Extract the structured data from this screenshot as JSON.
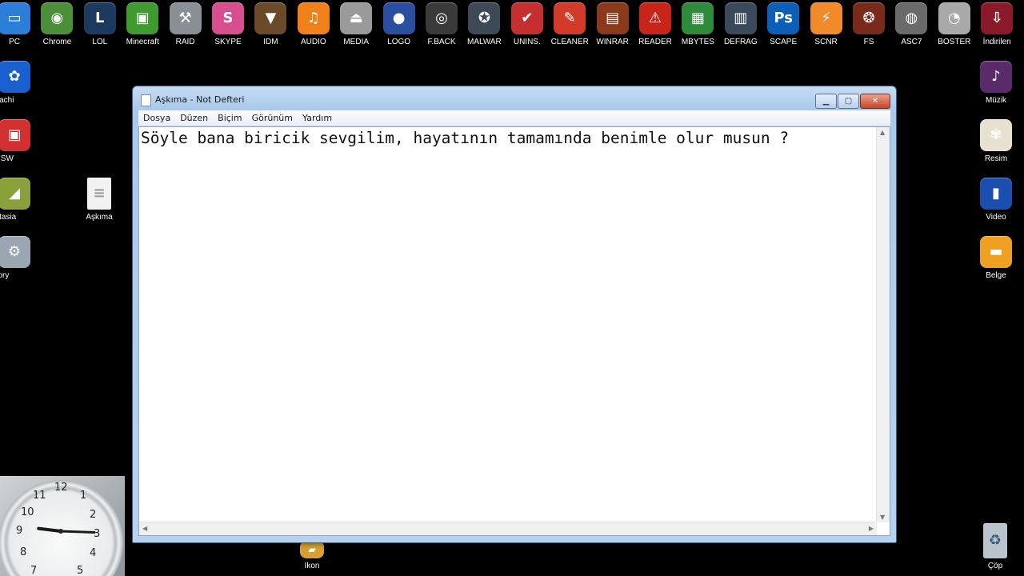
{
  "desktop": {
    "top_icons": [
      {
        "label": "PC",
        "icon": "monitor-icon",
        "color": "#2b7fd8",
        "glyph": "▭"
      },
      {
        "label": "Chrome",
        "icon": "chrome-icon",
        "color": "#4b8f3a",
        "glyph": "◉"
      },
      {
        "label": "LOL",
        "icon": "league-of-legends-icon",
        "color": "#1c3a60",
        "glyph": "L"
      },
      {
        "label": "Minecraft",
        "icon": "minecraft-creeper-icon",
        "color": "#3f9b2f",
        "glyph": "▣"
      },
      {
        "label": "RAID",
        "icon": "raid-tools-icon",
        "color": "#8a8f96",
        "glyph": "⚒"
      },
      {
        "label": "SKYPE",
        "icon": "skype-icon",
        "color": "#d84f8f",
        "glyph": "S"
      },
      {
        "label": "IDM",
        "icon": "idm-download-icon",
        "color": "#6b4a2a",
        "glyph": "▼"
      },
      {
        "label": "AUDIO",
        "icon": "music-note-icon",
        "color": "#f0801a",
        "glyph": "♫"
      },
      {
        "label": "MEDIA",
        "icon": "eject-icon",
        "color": "#9a9a9a",
        "glyph": "⏏"
      },
      {
        "label": "LOGO",
        "icon": "logo-icon",
        "color": "#2b4fa0",
        "glyph": "●"
      },
      {
        "label": "F.BACK",
        "icon": "camera-icon",
        "color": "#3a3a3a",
        "glyph": "◎"
      },
      {
        "label": "MALWAR",
        "icon": "shield-star-icon",
        "color": "#3d4a55",
        "glyph": "✪"
      },
      {
        "label": "UNINS.",
        "icon": "uninstall-icon",
        "color": "#c62f2f",
        "glyph": "✔"
      },
      {
        "label": "CLEANER",
        "icon": "broom-icon",
        "color": "#d23a2a",
        "glyph": "✎"
      },
      {
        "label": "WINRAR",
        "icon": "winrar-icon",
        "color": "#8a3a1a",
        "glyph": "▤"
      },
      {
        "label": "READER",
        "icon": "pdf-reader-icon",
        "color": "#c8241a",
        "glyph": "⚠"
      },
      {
        "label": "MBYTES",
        "icon": "windows-flag-icon",
        "color": "#2f8a3a",
        "glyph": "▦"
      },
      {
        "label": "DEFRAG",
        "icon": "defrag-icon",
        "color": "#3a4a5a",
        "glyph": "▥"
      },
      {
        "label": "SCAPE",
        "icon": "photoshop-icon",
        "color": "#0b5fb8",
        "glyph": "Ps"
      },
      {
        "label": "SCNR",
        "icon": "usb-icon",
        "color": "#f08a2a",
        "glyph": "⚡"
      },
      {
        "label": "FS",
        "icon": "film-reel-icon",
        "color": "#7a2a1a",
        "glyph": "❂"
      },
      {
        "label": "ASC7",
        "icon": "hard-drive-icon",
        "color": "#6a6a6a",
        "glyph": "◍"
      },
      {
        "label": "BOSTER",
        "icon": "gauge-icon",
        "color": "#a9a9a9",
        "glyph": "◔"
      },
      {
        "label": "İndirilen",
        "icon": "downloads-folder-icon",
        "color": "#8a1a2a",
        "glyph": "⇩"
      }
    ],
    "left_icons": [
      {
        "label": "Hamachi",
        "icon": "hamachi-icon",
        "color": "#1a5fd0",
        "glyph": "✿"
      },
      {
        "label": "MNCSW",
        "icon": "minecraft-server-icon",
        "color": "#d23030",
        "glyph": "▣"
      },
      {
        "label": "Camtasia",
        "icon": "camtasia-icon",
        "color": "#8aa03a",
        "glyph": "◢"
      },
      {
        "label": "Factory",
        "icon": "factory-icon",
        "color": "#9aa6b2",
        "glyph": "⚙"
      }
    ],
    "askima_icon": {
      "label": "Aşkıma",
      "icon": "text-file-icon",
      "color": "#e8e8e8",
      "glyph": "≡"
    },
    "right_icons": [
      {
        "label": "Müzik",
        "icon": "music-folder-icon",
        "color": "#5a2a6a",
        "glyph": "♪"
      },
      {
        "label": "Resim",
        "icon": "pictures-icon",
        "color": "#e8e0d0",
        "glyph": "✾"
      },
      {
        "label": "Video",
        "icon": "video-icon",
        "color": "#1a4fb0",
        "glyph": "▮"
      },
      {
        "label": "Belge",
        "icon": "documents-folder-icon",
        "color": "#f0a020",
        "glyph": "▬"
      }
    ],
    "bottom_icons": [
      {
        "label": "Ikon",
        "icon": "folder-icon",
        "color": "#d8a030",
        "glyph": "▰"
      },
      {
        "label": "Çöp",
        "icon": "recycle-bin-icon",
        "color": "#9aa8b4",
        "glyph": "♻"
      }
    ]
  },
  "notepad": {
    "title": "Aşkıma - Not Defteri",
    "menu": [
      "Dosya",
      "Düzen",
      "Biçim",
      "Görünüm",
      "Yardım"
    ],
    "content": "Söyle bana biricik sevgilim, hayatının tamamında benimle olur musun ?",
    "buttons": {
      "minimize": "▁",
      "maximize": "▢",
      "close": "✕"
    }
  },
  "clock": {
    "numbers": [
      "12",
      "1",
      "2",
      "3",
      "4",
      "5",
      "7",
      "8",
      "9",
      "10",
      "11"
    ],
    "hour_angle_deg": 277,
    "minute_angle_deg": 92
  }
}
